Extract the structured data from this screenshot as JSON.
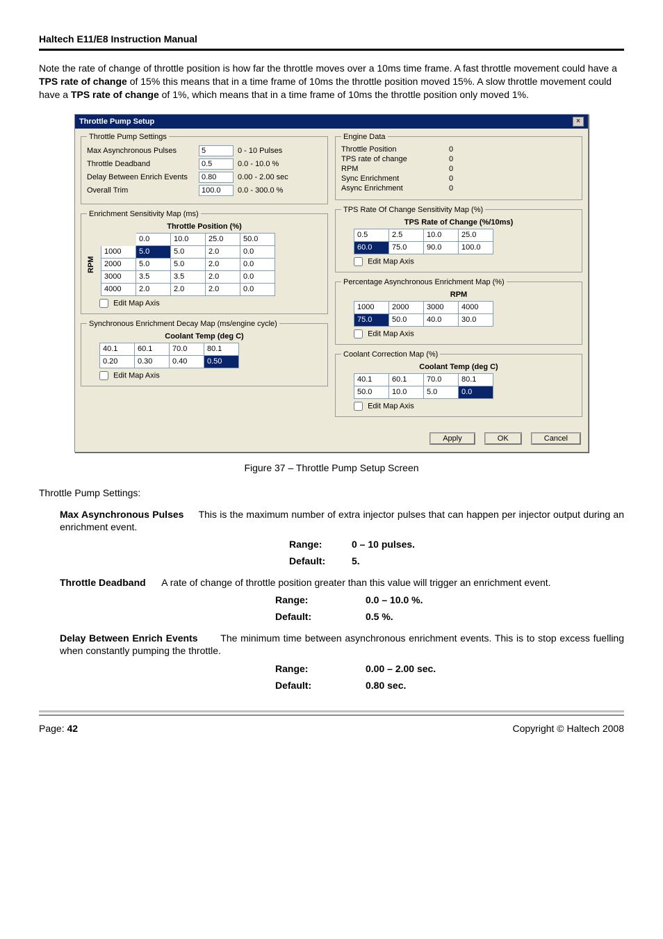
{
  "doc": {
    "header_title": "Haltech E11/E8 Instruction Manual",
    "intro_pre": "Note the rate of change of throttle position is how far the throttle moves over a 10ms time frame. A fast throttle movement could have a ",
    "intro_b1": "TPS rate of change",
    "intro_mid1": " of 15% this means that in a time frame of 10ms the throttle position moved 15%. A slow throttle movement could have a ",
    "intro_b2": "TPS rate of change",
    "intro_mid2": " of 1%, which means that in a time frame of 10ms the throttle position only moved 1%.",
    "figure_caption": "Figure 37 – Throttle Pump Setup Screen",
    "section_title": "Throttle Pump Settings:",
    "params": {
      "max_async": {
        "name": "Max Asynchronous Pulses",
        "text": "This is the maximum number of extra injector pulses that can happen per injector output during an enrichment event.",
        "range_label": "Range:",
        "range_val": "0 – 10 pulses.",
        "default_label": "Default:",
        "default_val": "5."
      },
      "deadband": {
        "name": "Throttle Deadband",
        "text": "A rate of change of throttle position greater than this value will trigger an enrichment event.",
        "range_label": "Range:",
        "range_val": "0.0 – 10.0 %.",
        "default_label": "Default:",
        "default_val": "0.5 %."
      },
      "delay": {
        "name": "Delay Between Enrich Events",
        "text": "The minimum time between asynchronous enrichment events. This is to stop excess fuelling when constantly pumping the throttle.",
        "range_label": "Range:",
        "range_val": "0.00 – 2.00 sec.",
        "default_label": "Default:",
        "default_val": "0.80 sec."
      }
    },
    "footer_page_label": "Page: ",
    "footer_page_num": "42",
    "footer_copyright": "Copyright © Haltech 2008"
  },
  "dialog": {
    "title": "Throttle Pump Setup",
    "close": "×",
    "groups": {
      "settings_legend": "Throttle Pump Settings",
      "engine_legend": "Engine Data",
      "enrich_sens_legend": "Enrichment Sensitivity Map (ms)",
      "sync_decay_legend": "Synchronous Enrichment Decay Map (ms/engine cycle)",
      "tps_sens_legend": "TPS Rate Of Change Sensitivity Map (%)",
      "async_enrich_legend": "Percentage Asynchronous Enrichment Map (%)",
      "coolant_corr_legend": "Coolant Correction Map (%)"
    },
    "settings": {
      "rows": [
        {
          "label": "Max Asynchronous Pulses",
          "value": "5",
          "range": "0 - 10 Pulses"
        },
        {
          "label": "Throttle Deadband",
          "value": "0.5",
          "range": "0.0 - 10.0 %"
        },
        {
          "label": "Delay Between Enrich Events",
          "value": "0.80",
          "range": "0.00 - 2.00 sec"
        },
        {
          "label": "Overall Trim",
          "value": "100.0",
          "range": "0.0 - 300.0 %"
        }
      ]
    },
    "engine": {
      "rows": [
        {
          "label": "Throttle Position",
          "value": "0"
        },
        {
          "label": "TPS rate of change",
          "value": "0"
        },
        {
          "label": "RPM",
          "value": "0"
        },
        {
          "label": "Sync Enrichment",
          "value": "0"
        },
        {
          "label": "Async Enrichment",
          "value": "0"
        }
      ]
    },
    "edit_map_axis": "Edit Map Axis",
    "enrich_sens": {
      "sub": "Throttle Position (%)",
      "vlabel": "RPM",
      "cols": [
        "0.0",
        "10.0",
        "25.0",
        "50.0"
      ],
      "rows": [
        {
          "h": "1000",
          "v": [
            "5.0",
            "5.0",
            "2.0",
            "0.0"
          ]
        },
        {
          "h": "2000",
          "v": [
            "5.0",
            "5.0",
            "2.0",
            "0.0"
          ]
        },
        {
          "h": "3000",
          "v": [
            "3.5",
            "3.5",
            "2.0",
            "0.0"
          ]
        },
        {
          "h": "4000",
          "v": [
            "2.0",
            "2.0",
            "2.0",
            "0.0"
          ]
        }
      ],
      "sel_cell": "5.0"
    },
    "sync_decay": {
      "sub": "Coolant Temp (deg C)",
      "cols": [
        "40.1",
        "60.1",
        "70.0",
        "80.1"
      ],
      "vals": [
        "0.20",
        "0.30",
        "0.40",
        "0.50"
      ],
      "sel_idx": 3
    },
    "tps_sens": {
      "sub": "TPS Rate of Change (%/10ms)",
      "cols": [
        "0.5",
        "2.5",
        "10.0",
        "25.0"
      ],
      "vals": [
        "60.0",
        "75.0",
        "90.0",
        "100.0"
      ],
      "sel_idx": 0
    },
    "async_enrich": {
      "sub": "RPM",
      "cols": [
        "1000",
        "2000",
        "3000",
        "4000"
      ],
      "vals": [
        "75.0",
        "50.0",
        "40.0",
        "30.0"
      ],
      "sel_idx": 0
    },
    "coolant_corr": {
      "sub": "Coolant Temp (deg C)",
      "cols": [
        "40.1",
        "60.1",
        "70.0",
        "80.1"
      ],
      "vals": [
        "50.0",
        "10.0",
        "5.0",
        "0.0"
      ],
      "sel_idx": 3
    },
    "buttons": {
      "apply": "Apply",
      "ok": "OK",
      "cancel": "Cancel"
    }
  }
}
